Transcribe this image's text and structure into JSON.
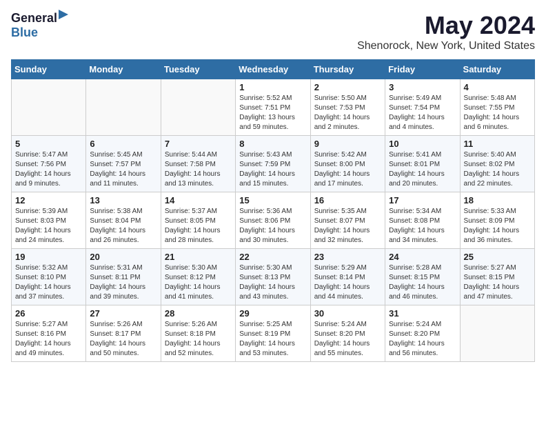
{
  "header": {
    "logo_general": "General",
    "logo_blue": "Blue",
    "main_title": "May 2024",
    "subtitle": "Shenorock, New York, United States"
  },
  "calendar": {
    "days_of_week": [
      "Sunday",
      "Monday",
      "Tuesday",
      "Wednesday",
      "Thursday",
      "Friday",
      "Saturday"
    ],
    "weeks": [
      [
        {
          "day": "",
          "info": ""
        },
        {
          "day": "",
          "info": ""
        },
        {
          "day": "",
          "info": ""
        },
        {
          "day": "1",
          "info": "Sunrise: 5:52 AM\nSunset: 7:51 PM\nDaylight: 13 hours\nand 59 minutes."
        },
        {
          "day": "2",
          "info": "Sunrise: 5:50 AM\nSunset: 7:53 PM\nDaylight: 14 hours\nand 2 minutes."
        },
        {
          "day": "3",
          "info": "Sunrise: 5:49 AM\nSunset: 7:54 PM\nDaylight: 14 hours\nand 4 minutes."
        },
        {
          "day": "4",
          "info": "Sunrise: 5:48 AM\nSunset: 7:55 PM\nDaylight: 14 hours\nand 6 minutes."
        }
      ],
      [
        {
          "day": "5",
          "info": "Sunrise: 5:47 AM\nSunset: 7:56 PM\nDaylight: 14 hours\nand 9 minutes."
        },
        {
          "day": "6",
          "info": "Sunrise: 5:45 AM\nSunset: 7:57 PM\nDaylight: 14 hours\nand 11 minutes."
        },
        {
          "day": "7",
          "info": "Sunrise: 5:44 AM\nSunset: 7:58 PM\nDaylight: 14 hours\nand 13 minutes."
        },
        {
          "day": "8",
          "info": "Sunrise: 5:43 AM\nSunset: 7:59 PM\nDaylight: 14 hours\nand 15 minutes."
        },
        {
          "day": "9",
          "info": "Sunrise: 5:42 AM\nSunset: 8:00 PM\nDaylight: 14 hours\nand 17 minutes."
        },
        {
          "day": "10",
          "info": "Sunrise: 5:41 AM\nSunset: 8:01 PM\nDaylight: 14 hours\nand 20 minutes."
        },
        {
          "day": "11",
          "info": "Sunrise: 5:40 AM\nSunset: 8:02 PM\nDaylight: 14 hours\nand 22 minutes."
        }
      ],
      [
        {
          "day": "12",
          "info": "Sunrise: 5:39 AM\nSunset: 8:03 PM\nDaylight: 14 hours\nand 24 minutes."
        },
        {
          "day": "13",
          "info": "Sunrise: 5:38 AM\nSunset: 8:04 PM\nDaylight: 14 hours\nand 26 minutes."
        },
        {
          "day": "14",
          "info": "Sunrise: 5:37 AM\nSunset: 8:05 PM\nDaylight: 14 hours\nand 28 minutes."
        },
        {
          "day": "15",
          "info": "Sunrise: 5:36 AM\nSunset: 8:06 PM\nDaylight: 14 hours\nand 30 minutes."
        },
        {
          "day": "16",
          "info": "Sunrise: 5:35 AM\nSunset: 8:07 PM\nDaylight: 14 hours\nand 32 minutes."
        },
        {
          "day": "17",
          "info": "Sunrise: 5:34 AM\nSunset: 8:08 PM\nDaylight: 14 hours\nand 34 minutes."
        },
        {
          "day": "18",
          "info": "Sunrise: 5:33 AM\nSunset: 8:09 PM\nDaylight: 14 hours\nand 36 minutes."
        }
      ],
      [
        {
          "day": "19",
          "info": "Sunrise: 5:32 AM\nSunset: 8:10 PM\nDaylight: 14 hours\nand 37 minutes."
        },
        {
          "day": "20",
          "info": "Sunrise: 5:31 AM\nSunset: 8:11 PM\nDaylight: 14 hours\nand 39 minutes."
        },
        {
          "day": "21",
          "info": "Sunrise: 5:30 AM\nSunset: 8:12 PM\nDaylight: 14 hours\nand 41 minutes."
        },
        {
          "day": "22",
          "info": "Sunrise: 5:30 AM\nSunset: 8:13 PM\nDaylight: 14 hours\nand 43 minutes."
        },
        {
          "day": "23",
          "info": "Sunrise: 5:29 AM\nSunset: 8:14 PM\nDaylight: 14 hours\nand 44 minutes."
        },
        {
          "day": "24",
          "info": "Sunrise: 5:28 AM\nSunset: 8:15 PM\nDaylight: 14 hours\nand 46 minutes."
        },
        {
          "day": "25",
          "info": "Sunrise: 5:27 AM\nSunset: 8:15 PM\nDaylight: 14 hours\nand 47 minutes."
        }
      ],
      [
        {
          "day": "26",
          "info": "Sunrise: 5:27 AM\nSunset: 8:16 PM\nDaylight: 14 hours\nand 49 minutes."
        },
        {
          "day": "27",
          "info": "Sunrise: 5:26 AM\nSunset: 8:17 PM\nDaylight: 14 hours\nand 50 minutes."
        },
        {
          "day": "28",
          "info": "Sunrise: 5:26 AM\nSunset: 8:18 PM\nDaylight: 14 hours\nand 52 minutes."
        },
        {
          "day": "29",
          "info": "Sunrise: 5:25 AM\nSunset: 8:19 PM\nDaylight: 14 hours\nand 53 minutes."
        },
        {
          "day": "30",
          "info": "Sunrise: 5:24 AM\nSunset: 8:20 PM\nDaylight: 14 hours\nand 55 minutes."
        },
        {
          "day": "31",
          "info": "Sunrise: 5:24 AM\nSunset: 8:20 PM\nDaylight: 14 hours\nand 56 minutes."
        },
        {
          "day": "",
          "info": ""
        }
      ]
    ]
  }
}
